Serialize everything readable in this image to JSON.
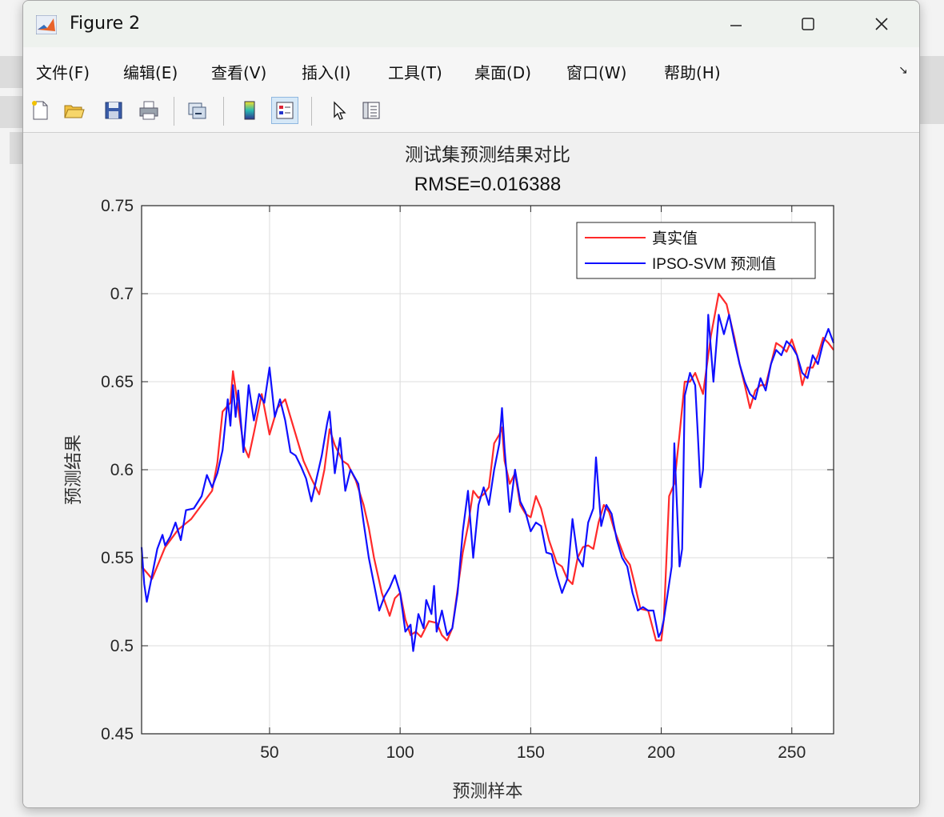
{
  "window": {
    "title": "Figure 2"
  },
  "menu": [
    "文件(F)",
    "编辑(E)",
    "查看(V)",
    "插入(I)",
    "工具(T)",
    "桌面(D)",
    "窗口(W)",
    "帮助(H)"
  ],
  "toolbar": [
    "new-figure-icon",
    "open-folder-icon",
    "save-icon",
    "print-icon",
    "link-plot-icon",
    "colorbar-icon",
    "legend-icon",
    "pointer-icon",
    "property-inspector-icon"
  ],
  "colors": {
    "true_series": "#ff2a2a",
    "pred_series": "#1010ff"
  },
  "chart_data": {
    "type": "line",
    "title": "测试集预测结果对比",
    "subtitle": "RMSE=0.016388",
    "xlabel": "预测样本",
    "ylabel": "预测结果",
    "xlim": [
      1,
      266
    ],
    "ylim": [
      0.45,
      0.75
    ],
    "xticks": [
      50,
      100,
      150,
      200,
      250
    ],
    "yticks": [
      0.45,
      0.5,
      0.55,
      0.6,
      0.65,
      0.7,
      0.75
    ],
    "grid": true,
    "legend_position": "top-right",
    "series": [
      {
        "name": "真实值",
        "color": "#ff2a2a",
        "keypoints": [
          [
            1,
            0.545
          ],
          [
            5,
            0.538
          ],
          [
            10,
            0.556
          ],
          [
            15,
            0.566
          ],
          [
            20,
            0.572
          ],
          [
            25,
            0.582
          ],
          [
            28,
            0.588
          ],
          [
            30,
            0.604
          ],
          [
            32,
            0.633
          ],
          [
            35,
            0.638
          ],
          [
            36,
            0.656
          ],
          [
            38,
            0.635
          ],
          [
            40,
            0.614
          ],
          [
            42,
            0.607
          ],
          [
            44,
            0.621
          ],
          [
            47,
            0.643
          ],
          [
            50,
            0.62
          ],
          [
            53,
            0.635
          ],
          [
            56,
            0.64
          ],
          [
            60,
            0.62
          ],
          [
            63,
            0.605
          ],
          [
            66,
            0.595
          ],
          [
            69,
            0.586
          ],
          [
            71,
            0.6
          ],
          [
            73,
            0.623
          ],
          [
            75,
            0.614
          ],
          [
            78,
            0.605
          ],
          [
            80,
            0.603
          ],
          [
            83,
            0.594
          ],
          [
            86,
            0.58
          ],
          [
            88,
            0.567
          ],
          [
            90,
            0.55
          ],
          [
            93,
            0.53
          ],
          [
            96,
            0.517
          ],
          [
            98,
            0.527
          ],
          [
            100,
            0.53
          ],
          [
            102,
            0.515
          ],
          [
            104,
            0.506
          ],
          [
            106,
            0.508
          ],
          [
            108,
            0.505
          ],
          [
            111,
            0.514
          ],
          [
            114,
            0.513
          ],
          [
            116,
            0.506
          ],
          [
            118,
            0.503
          ],
          [
            120,
            0.51
          ],
          [
            122,
            0.532
          ],
          [
            124,
            0.553
          ],
          [
            126,
            0.568
          ],
          [
            128,
            0.588
          ],
          [
            130,
            0.584
          ],
          [
            132,
            0.586
          ],
          [
            134,
            0.59
          ],
          [
            136,
            0.615
          ],
          [
            138,
            0.62
          ],
          [
            139,
            0.624
          ],
          [
            140,
            0.605
          ],
          [
            142,
            0.592
          ],
          [
            144,
            0.598
          ],
          [
            146,
            0.58
          ],
          [
            148,
            0.575
          ],
          [
            150,
            0.573
          ],
          [
            152,
            0.585
          ],
          [
            154,
            0.578
          ],
          [
            157,
            0.56
          ],
          [
            160,
            0.547
          ],
          [
            162,
            0.545
          ],
          [
            164,
            0.538
          ],
          [
            166,
            0.535
          ],
          [
            168,
            0.55
          ],
          [
            170,
            0.556
          ],
          [
            172,
            0.557
          ],
          [
            174,
            0.555
          ],
          [
            176,
            0.57
          ],
          [
            178,
            0.58
          ],
          [
            180,
            0.576
          ],
          [
            182,
            0.566
          ],
          [
            184,
            0.558
          ],
          [
            186,
            0.55
          ],
          [
            188,
            0.546
          ],
          [
            190,
            0.534
          ],
          [
            192,
            0.521
          ],
          [
            195,
            0.52
          ],
          [
            198,
            0.503
          ],
          [
            200,
            0.503
          ],
          [
            201,
            0.515
          ],
          [
            203,
            0.585
          ],
          [
            205,
            0.592
          ],
          [
            207,
            0.62
          ],
          [
            209,
            0.65
          ],
          [
            211,
            0.65
          ],
          [
            213,
            0.655
          ],
          [
            216,
            0.643
          ],
          [
            219,
            0.676
          ],
          [
            222,
            0.7
          ],
          [
            225,
            0.694
          ],
          [
            228,
            0.675
          ],
          [
            230,
            0.66
          ],
          [
            232,
            0.648
          ],
          [
            234,
            0.635
          ],
          [
            236,
            0.645
          ],
          [
            238,
            0.648
          ],
          [
            240,
            0.648
          ],
          [
            242,
            0.66
          ],
          [
            244,
            0.672
          ],
          [
            246,
            0.67
          ],
          [
            248,
            0.667
          ],
          [
            250,
            0.674
          ],
          [
            252,
            0.665
          ],
          [
            254,
            0.648
          ],
          [
            256,
            0.658
          ],
          [
            258,
            0.658
          ],
          [
            260,
            0.665
          ],
          [
            262,
            0.675
          ],
          [
            264,
            0.672
          ],
          [
            266,
            0.668
          ]
        ]
      },
      {
        "name": "IPSO-SVM 预测值",
        "color": "#1010ff",
        "keypoints": [
          [
            1,
            0.556
          ],
          [
            2,
            0.535
          ],
          [
            3,
            0.525
          ],
          [
            5,
            0.54
          ],
          [
            7,
            0.555
          ],
          [
            9,
            0.563
          ],
          [
            10,
            0.557
          ],
          [
            12,
            0.562
          ],
          [
            14,
            0.57
          ],
          [
            16,
            0.56
          ],
          [
            18,
            0.577
          ],
          [
            21,
            0.578
          ],
          [
            24,
            0.585
          ],
          [
            26,
            0.597
          ],
          [
            28,
            0.59
          ],
          [
            30,
            0.598
          ],
          [
            32,
            0.611
          ],
          [
            34,
            0.64
          ],
          [
            35,
            0.625
          ],
          [
            36,
            0.648
          ],
          [
            37,
            0.63
          ],
          [
            38,
            0.645
          ],
          [
            40,
            0.61
          ],
          [
            42,
            0.648
          ],
          [
            44,
            0.628
          ],
          [
            46,
            0.643
          ],
          [
            48,
            0.638
          ],
          [
            50,
            0.658
          ],
          [
            52,
            0.63
          ],
          [
            54,
            0.64
          ],
          [
            56,
            0.628
          ],
          [
            58,
            0.61
          ],
          [
            60,
            0.608
          ],
          [
            62,
            0.602
          ],
          [
            64,
            0.595
          ],
          [
            66,
            0.582
          ],
          [
            68,
            0.595
          ],
          [
            70,
            0.608
          ],
          [
            72,
            0.626
          ],
          [
            73,
            0.633
          ],
          [
            75,
            0.598
          ],
          [
            77,
            0.618
          ],
          [
            79,
            0.588
          ],
          [
            81,
            0.6
          ],
          [
            84,
            0.592
          ],
          [
            86,
            0.57
          ],
          [
            88,
            0.55
          ],
          [
            90,
            0.535
          ],
          [
            92,
            0.52
          ],
          [
            94,
            0.528
          ],
          [
            96,
            0.533
          ],
          [
            98,
            0.54
          ],
          [
            100,
            0.53
          ],
          [
            102,
            0.508
          ],
          [
            104,
            0.512
          ],
          [
            105,
            0.497
          ],
          [
            107,
            0.518
          ],
          [
            109,
            0.51
          ],
          [
            110,
            0.526
          ],
          [
            112,
            0.518
          ],
          [
            113,
            0.534
          ],
          [
            114,
            0.508
          ],
          [
            116,
            0.52
          ],
          [
            118,
            0.506
          ],
          [
            120,
            0.51
          ],
          [
            122,
            0.53
          ],
          [
            124,
            0.565
          ],
          [
            126,
            0.588
          ],
          [
            128,
            0.55
          ],
          [
            130,
            0.58
          ],
          [
            132,
            0.59
          ],
          [
            134,
            0.58
          ],
          [
            136,
            0.6
          ],
          [
            138,
            0.615
          ],
          [
            139,
            0.635
          ],
          [
            140,
            0.612
          ],
          [
            142,
            0.576
          ],
          [
            144,
            0.6
          ],
          [
            146,
            0.582
          ],
          [
            148,
            0.576
          ],
          [
            150,
            0.565
          ],
          [
            152,
            0.57
          ],
          [
            154,
            0.568
          ],
          [
            156,
            0.553
          ],
          [
            158,
            0.552
          ],
          [
            160,
            0.54
          ],
          [
            162,
            0.53
          ],
          [
            164,
            0.538
          ],
          [
            166,
            0.572
          ],
          [
            168,
            0.55
          ],
          [
            170,
            0.545
          ],
          [
            172,
            0.57
          ],
          [
            174,
            0.578
          ],
          [
            175,
            0.607
          ],
          [
            177,
            0.568
          ],
          [
            179,
            0.58
          ],
          [
            181,
            0.575
          ],
          [
            183,
            0.56
          ],
          [
            185,
            0.55
          ],
          [
            187,
            0.545
          ],
          [
            189,
            0.53
          ],
          [
            191,
            0.52
          ],
          [
            193,
            0.522
          ],
          [
            195,
            0.52
          ],
          [
            197,
            0.52
          ],
          [
            199,
            0.505
          ],
          [
            200,
            0.508
          ],
          [
            201,
            0.515
          ],
          [
            202,
            0.525
          ],
          [
            204,
            0.545
          ],
          [
            205,
            0.615
          ],
          [
            207,
            0.545
          ],
          [
            208,
            0.555
          ],
          [
            209,
            0.642
          ],
          [
            211,
            0.655
          ],
          [
            213,
            0.648
          ],
          [
            214,
            0.62
          ],
          [
            215,
            0.59
          ],
          [
            216,
            0.6
          ],
          [
            218,
            0.688
          ],
          [
            220,
            0.65
          ],
          [
            222,
            0.688
          ],
          [
            224,
            0.677
          ],
          [
            226,
            0.688
          ],
          [
            228,
            0.673
          ],
          [
            230,
            0.66
          ],
          [
            232,
            0.65
          ],
          [
            234,
            0.643
          ],
          [
            236,
            0.64
          ],
          [
            238,
            0.652
          ],
          [
            240,
            0.645
          ],
          [
            242,
            0.66
          ],
          [
            244,
            0.668
          ],
          [
            246,
            0.665
          ],
          [
            248,
            0.673
          ],
          [
            250,
            0.67
          ],
          [
            252,
            0.665
          ],
          [
            254,
            0.655
          ],
          [
            256,
            0.652
          ],
          [
            258,
            0.665
          ],
          [
            260,
            0.66
          ],
          [
            262,
            0.672
          ],
          [
            264,
            0.68
          ],
          [
            266,
            0.672
          ]
        ]
      }
    ]
  }
}
